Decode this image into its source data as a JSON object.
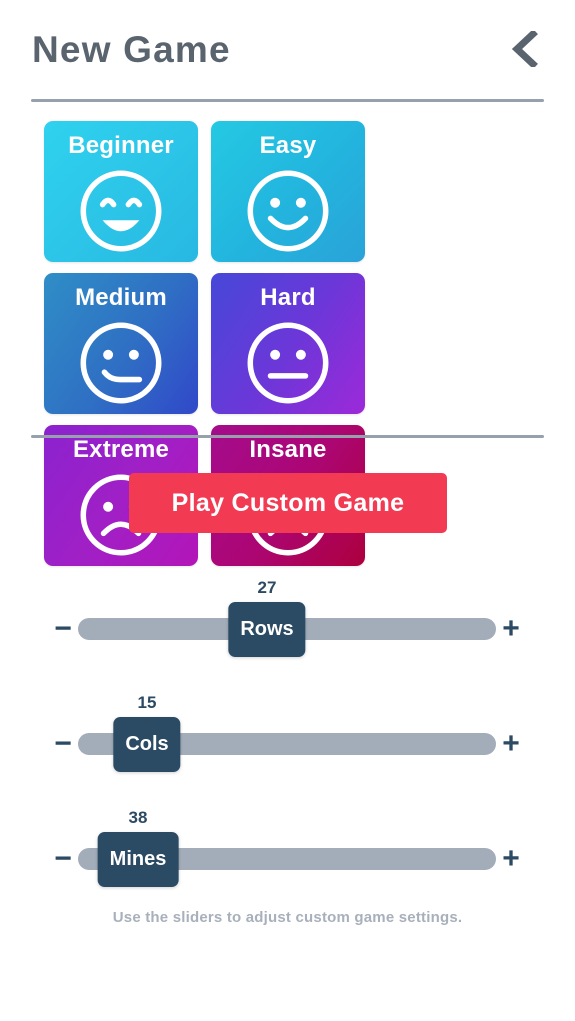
{
  "header": {
    "title": "New Game",
    "back_icon": "chevron-left-icon"
  },
  "difficulties": [
    {
      "label": "Beginner",
      "face": "smiling-face-happy-eyes",
      "color_from": "#2fd2ef",
      "color_to": "#28b8e2"
    },
    {
      "label": "Easy",
      "face": "smiling-face",
      "color_from": "#24c9e3",
      "color_to": "#2aa3d8"
    },
    {
      "label": "Medium",
      "face": "slight-smile-face",
      "color_from": "#2f8ec6",
      "color_to": "#3148c9"
    },
    {
      "label": "Hard",
      "face": "neutral-face",
      "color_from": "#4648d8",
      "color_to": "#9d29d9"
    },
    {
      "label": "Extreme",
      "face": "frowning-face",
      "color_from": "#8b22cf",
      "color_to": "#b315b8"
    },
    {
      "label": "Insane",
      "face": "dead-face-x-eyes",
      "color_from": "#a40c8c",
      "color_to": "#ad003e"
    }
  ],
  "play_button": {
    "label": "Play Custom Game",
    "color": "#f23b53"
  },
  "sliders": [
    {
      "name": "Rows",
      "value": "27",
      "percent": 46
    },
    {
      "name": "Cols",
      "value": "15",
      "percent": 16
    },
    {
      "name": "Mines",
      "value": "38",
      "percent": 14
    },
    {
      "decrement_label": "−",
      "increment_label": "+"
    }
  ],
  "slider_controls": {
    "decrement_label": "−",
    "increment_label": "+"
  },
  "hint": {
    "text": "Use the sliders to adjust custom game settings."
  },
  "colors": {
    "track": "#a3adba",
    "thumb": "#2b4a63",
    "title": "#5a646e",
    "divider": "#97a0ad",
    "hint": "#a8b0bb"
  }
}
